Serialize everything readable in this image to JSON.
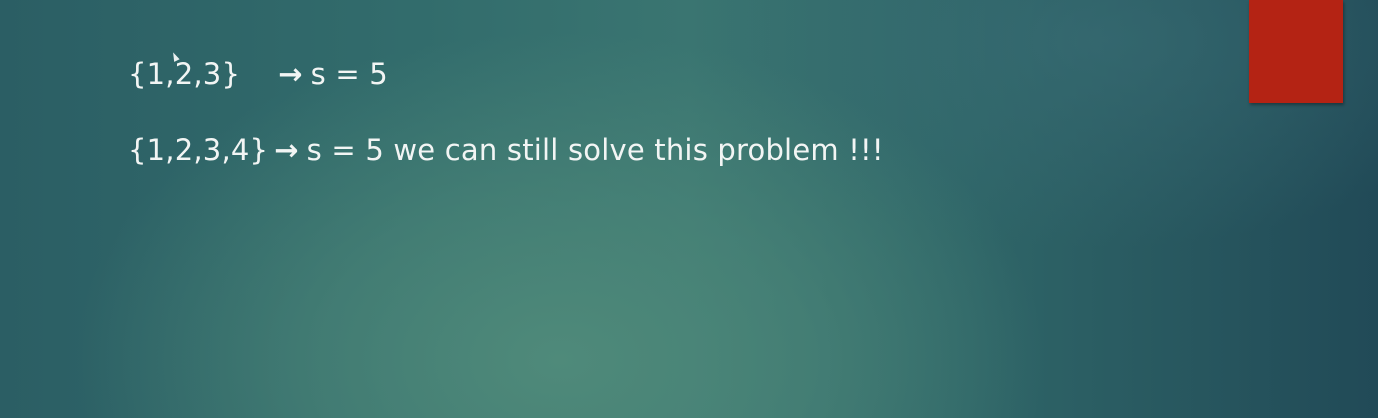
{
  "slide": {
    "lines": [
      {
        "set": "{1,2,3}",
        "arrow": "→",
        "result": "s = 5",
        "comment": ""
      },
      {
        "set": "{1,2,3,4}",
        "arrow": "→",
        "result": "s = 5",
        "comment": "we can still solve this problem !!!"
      }
    ],
    "accent_color": "#b42314"
  }
}
